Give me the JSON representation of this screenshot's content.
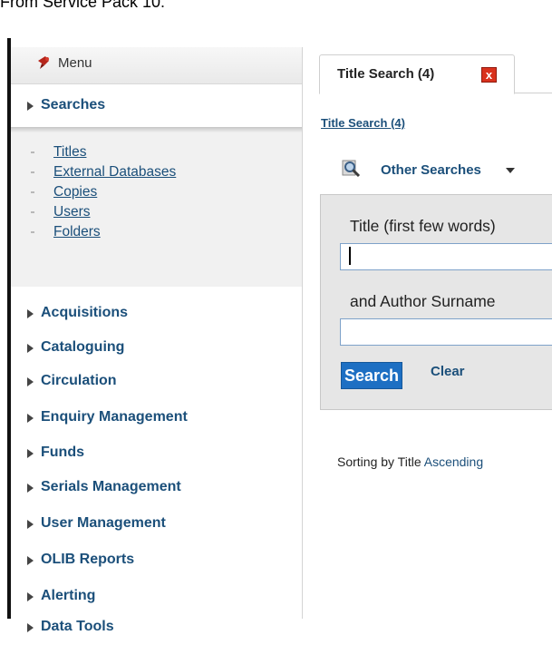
{
  "caption": "From Service Pack 10:",
  "menu": {
    "label": "Menu"
  },
  "sections": [
    {
      "label": "Searches"
    },
    {
      "label": "Acquisitions"
    },
    {
      "label": "Cataloguing"
    },
    {
      "label": "Circulation"
    },
    {
      "label": "Enquiry Management"
    },
    {
      "label": "Funds"
    },
    {
      "label": "Serials Management"
    },
    {
      "label": "User Management"
    },
    {
      "label": "OLIB Reports"
    },
    {
      "label": "Alerting"
    },
    {
      "label": "Data Tools"
    }
  ],
  "search_items": [
    {
      "label": "Titles"
    },
    {
      "label": "External Databases"
    },
    {
      "label": "Copies"
    },
    {
      "label": "Users"
    },
    {
      "label": "Folders"
    }
  ],
  "tab": {
    "label": "Title Search (4)",
    "close": "x"
  },
  "breadcrumb": "Title Search (4)",
  "other_searches": "Other Searches",
  "form": {
    "title_label": "Title (first few words)",
    "title_value": "",
    "author_label": "and Author Surname",
    "author_value": "",
    "search_button": "Search",
    "clear_link": "Clear"
  },
  "sorting": {
    "prefix": "Sorting by Title",
    "order": "Ascending"
  },
  "colors": {
    "link": "#1b4f7a",
    "button": "#1d6fc3",
    "close": "#d9321d"
  }
}
